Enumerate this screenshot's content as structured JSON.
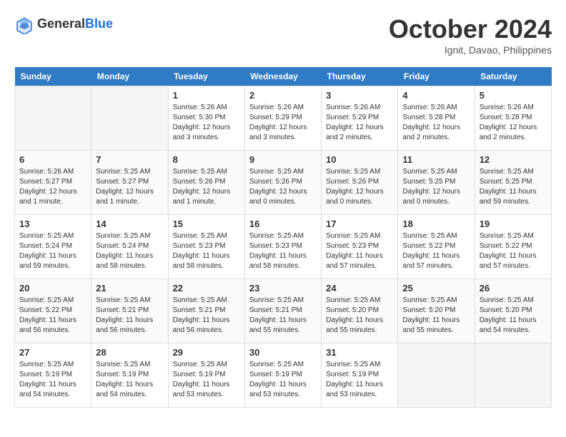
{
  "header": {
    "logo_line1": "General",
    "logo_line2": "Blue",
    "month": "October 2024",
    "location": "Ignit, Davao, Philippines"
  },
  "calendar": {
    "days_of_week": [
      "Sunday",
      "Monday",
      "Tuesday",
      "Wednesday",
      "Thursday",
      "Friday",
      "Saturday"
    ],
    "weeks": [
      [
        {
          "day": "",
          "info": ""
        },
        {
          "day": "",
          "info": ""
        },
        {
          "day": "1",
          "info": "Sunrise: 5:26 AM\nSunset: 5:30 PM\nDaylight: 12 hours and 3 minutes."
        },
        {
          "day": "2",
          "info": "Sunrise: 5:26 AM\nSunset: 5:29 PM\nDaylight: 12 hours and 3 minutes."
        },
        {
          "day": "3",
          "info": "Sunrise: 5:26 AM\nSunset: 5:29 PM\nDaylight: 12 hours and 2 minutes."
        },
        {
          "day": "4",
          "info": "Sunrise: 5:26 AM\nSunset: 5:28 PM\nDaylight: 12 hours and 2 minutes."
        },
        {
          "day": "5",
          "info": "Sunrise: 5:26 AM\nSunset: 5:28 PM\nDaylight: 12 hours and 2 minutes."
        }
      ],
      [
        {
          "day": "6",
          "info": "Sunrise: 5:26 AM\nSunset: 5:27 PM\nDaylight: 12 hours and 1 minute."
        },
        {
          "day": "7",
          "info": "Sunrise: 5:25 AM\nSunset: 5:27 PM\nDaylight: 12 hours and 1 minute."
        },
        {
          "day": "8",
          "info": "Sunrise: 5:25 AM\nSunset: 5:26 PM\nDaylight: 12 hours and 1 minute."
        },
        {
          "day": "9",
          "info": "Sunrise: 5:25 AM\nSunset: 5:26 PM\nDaylight: 12 hours and 0 minutes."
        },
        {
          "day": "10",
          "info": "Sunrise: 5:25 AM\nSunset: 5:26 PM\nDaylight: 12 hours and 0 minutes."
        },
        {
          "day": "11",
          "info": "Sunrise: 5:25 AM\nSunset: 5:25 PM\nDaylight: 12 hours and 0 minutes."
        },
        {
          "day": "12",
          "info": "Sunrise: 5:25 AM\nSunset: 5:25 PM\nDaylight: 11 hours and 59 minutes."
        }
      ],
      [
        {
          "day": "13",
          "info": "Sunrise: 5:25 AM\nSunset: 5:24 PM\nDaylight: 11 hours and 59 minutes."
        },
        {
          "day": "14",
          "info": "Sunrise: 5:25 AM\nSunset: 5:24 PM\nDaylight: 11 hours and 58 minutes."
        },
        {
          "day": "15",
          "info": "Sunrise: 5:25 AM\nSunset: 5:23 PM\nDaylight: 11 hours and 58 minutes."
        },
        {
          "day": "16",
          "info": "Sunrise: 5:25 AM\nSunset: 5:23 PM\nDaylight: 11 hours and 58 minutes."
        },
        {
          "day": "17",
          "info": "Sunrise: 5:25 AM\nSunset: 5:23 PM\nDaylight: 11 hours and 57 minutes."
        },
        {
          "day": "18",
          "info": "Sunrise: 5:25 AM\nSunset: 5:22 PM\nDaylight: 11 hours and 57 minutes."
        },
        {
          "day": "19",
          "info": "Sunrise: 5:25 AM\nSunset: 5:22 PM\nDaylight: 11 hours and 57 minutes."
        }
      ],
      [
        {
          "day": "20",
          "info": "Sunrise: 5:25 AM\nSunset: 5:22 PM\nDaylight: 11 hours and 56 minutes."
        },
        {
          "day": "21",
          "info": "Sunrise: 5:25 AM\nSunset: 5:21 PM\nDaylight: 11 hours and 56 minutes."
        },
        {
          "day": "22",
          "info": "Sunrise: 5:25 AM\nSunset: 5:21 PM\nDaylight: 11 hours and 56 minutes."
        },
        {
          "day": "23",
          "info": "Sunrise: 5:25 AM\nSunset: 5:21 PM\nDaylight: 11 hours and 55 minutes."
        },
        {
          "day": "24",
          "info": "Sunrise: 5:25 AM\nSunset: 5:20 PM\nDaylight: 11 hours and 55 minutes."
        },
        {
          "day": "25",
          "info": "Sunrise: 5:25 AM\nSunset: 5:20 PM\nDaylight: 11 hours and 55 minutes."
        },
        {
          "day": "26",
          "info": "Sunrise: 5:25 AM\nSunset: 5:20 PM\nDaylight: 11 hours and 54 minutes."
        }
      ],
      [
        {
          "day": "27",
          "info": "Sunrise: 5:25 AM\nSunset: 5:19 PM\nDaylight: 11 hours and 54 minutes."
        },
        {
          "day": "28",
          "info": "Sunrise: 5:25 AM\nSunset: 5:19 PM\nDaylight: 11 hours and 54 minutes."
        },
        {
          "day": "29",
          "info": "Sunrise: 5:25 AM\nSunset: 5:19 PM\nDaylight: 11 hours and 53 minutes."
        },
        {
          "day": "30",
          "info": "Sunrise: 5:25 AM\nSunset: 5:19 PM\nDaylight: 11 hours and 53 minutes."
        },
        {
          "day": "31",
          "info": "Sunrise: 5:25 AM\nSunset: 5:19 PM\nDaylight: 11 hours and 53 minutes."
        },
        {
          "day": "",
          "info": ""
        },
        {
          "day": "",
          "info": ""
        }
      ]
    ]
  }
}
